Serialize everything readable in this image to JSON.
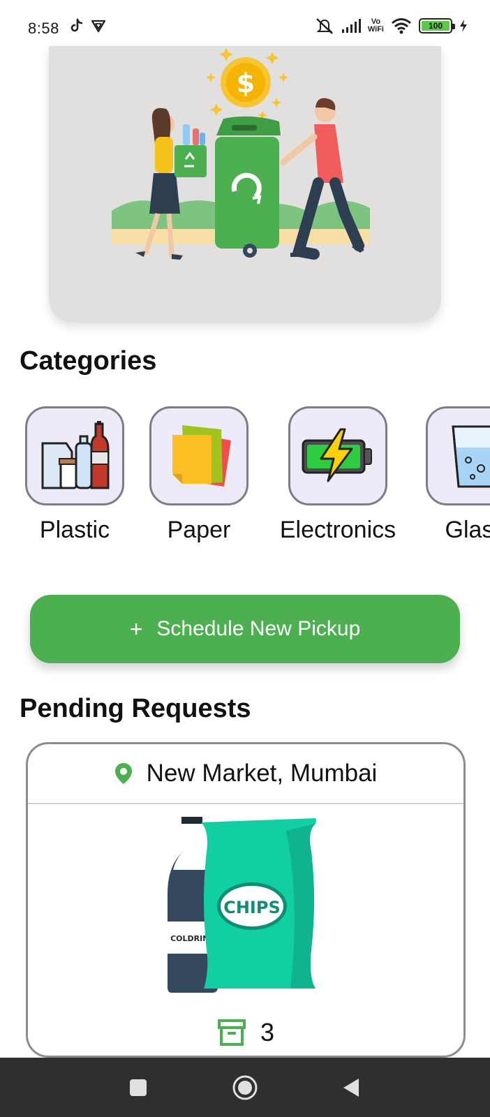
{
  "status_bar": {
    "time": "8:58",
    "wifi_label_top": "Vo",
    "wifi_label_bottom": "WiFi",
    "battery": "100"
  },
  "sections": {
    "categories_title": "Categories",
    "pending_title": "Pending Requests"
  },
  "categories": [
    {
      "label": "Plastic",
      "icon": "plastic-bottles-icon"
    },
    {
      "label": "Paper",
      "icon": "paper-sheets-icon"
    },
    {
      "label": "Electronics",
      "icon": "battery-charging-icon"
    },
    {
      "label": "Glass",
      "icon": "water-glass-icon"
    }
  ],
  "actions": {
    "schedule_label": "Schedule New Pickup",
    "schedule_icon": "plus-icon"
  },
  "pending_request": {
    "location": "New Market, Mumbai",
    "location_icon": "location-pin-icon",
    "image_labels": {
      "bag": "CHIPS",
      "bottle": "COLDRINK"
    },
    "count": "3",
    "count_icon": "archive-box-icon"
  },
  "colors": {
    "brand_green": "#4caf50",
    "hero_bg": "#e2e0df",
    "tile_bg": "#ecebf7",
    "nav_bg": "#2f2f2f"
  }
}
